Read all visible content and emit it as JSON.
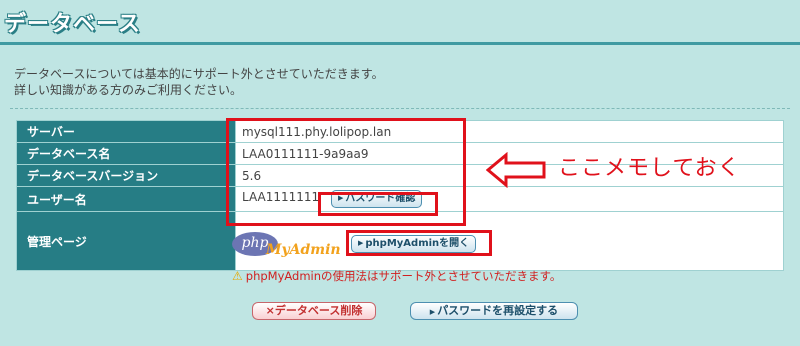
{
  "page": {
    "title": "データベース",
    "intro_line1": "データベースについては基本的にサポート外とさせていただきます。",
    "intro_line2": "詳しい知識がある方のみご利用ください。"
  },
  "table": {
    "server_label": "サーバー",
    "server_value": "mysql111.phy.lolipop.lan",
    "dbname_label": "データベース名",
    "dbname_value": "LAA0111111-9a9aa9",
    "version_label": "データベースバージョン",
    "version_value": "5.6",
    "user_label": "ユーザー名",
    "user_value": "LAA1111111",
    "password_check_label": "パスワード確認",
    "admin_label": "管理ページ",
    "phpmyadmin_logo_php": "php",
    "phpmyadmin_logo_admin": "MyAdmin",
    "open_phpmyadmin_label": "phpMyAdminを開く",
    "phpmyadmin_warning": "phpMyAdminの使用法はサポート外とさせていただきます。"
  },
  "annotation": {
    "memo_text": "ここメモしておく",
    "color": "#e0111b"
  },
  "actions": {
    "delete_label": "×データベース削除",
    "reset_password_label": "パスワードを再設定する"
  },
  "colors": {
    "background": "#bfe5e3",
    "label_cell": "#267d85",
    "title_rule": "#3f9aa2"
  },
  "icons": {
    "warning": "warning-icon",
    "button_marker": "triangle-right-icon",
    "memo_arrow": "left-arrow-icon"
  }
}
